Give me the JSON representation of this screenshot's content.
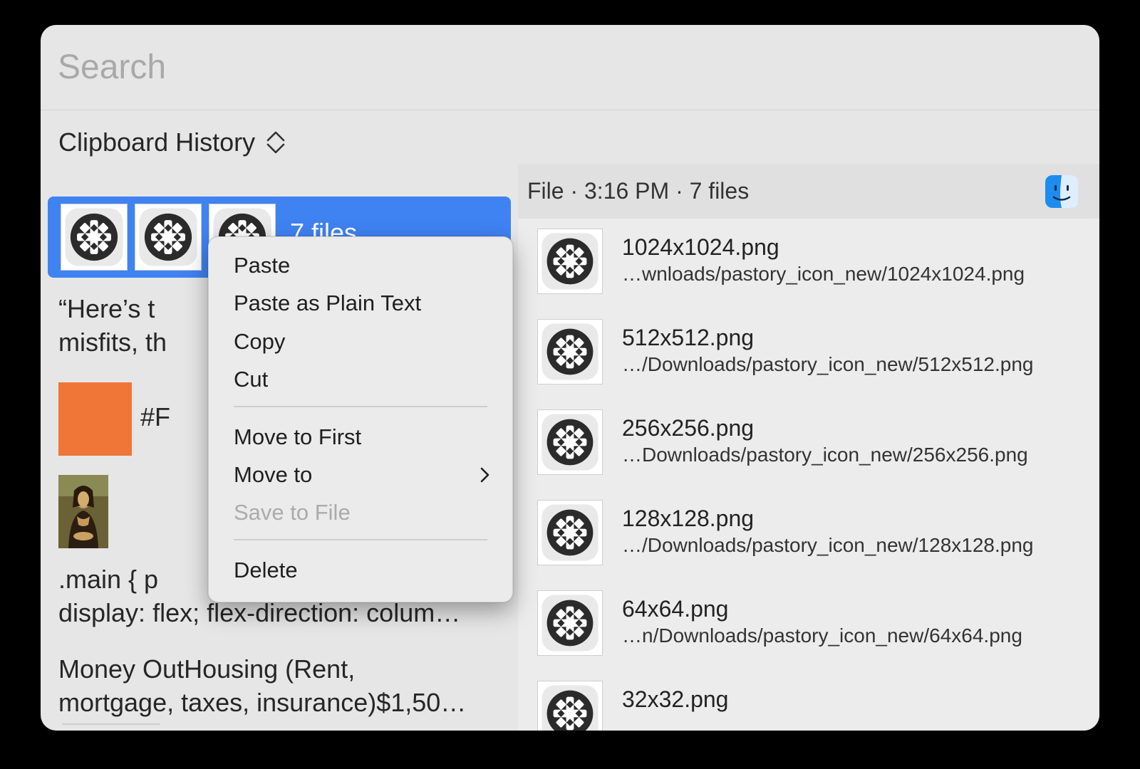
{
  "search": {
    "placeholder": "Search",
    "value": ""
  },
  "source": {
    "label": "Clipboard History",
    "icon": "up-down-chevron-icon"
  },
  "history": {
    "selected": {
      "count_label": "7 files",
      "icon": "pastory-app-icon"
    },
    "quote_line1": "“Here’s t",
    "quote_line2": "misfits, th",
    "quote_tail": "…",
    "color": {
      "swatch": "#F07638",
      "label": "#F"
    },
    "image_icon": "mona-lisa-thumbnail",
    "code_line1": ".main {  p",
    "code_line2": "display: flex;  flex-direction: colum…",
    "money_line1": "Money OutHousing (Rent,",
    "money_line2": "mortgage, taxes, insurance)$1,50…"
  },
  "detail": {
    "header": "File · 3:16 PM · 7 files",
    "icon": "finder-icon",
    "files": [
      {
        "name": "1024x1024.png",
        "path": "…wnloads/pastory_icon_new/1024x1024.png"
      },
      {
        "name": "512x512.png",
        "path": "…/Downloads/pastory_icon_new/512x512.png"
      },
      {
        "name": "256x256.png",
        "path": "…Downloads/pastory_icon_new/256x256.png"
      },
      {
        "name": "128x128.png",
        "path": "…/Downloads/pastory_icon_new/128x128.png"
      },
      {
        "name": "64x64.png",
        "path": "…n/Downloads/pastory_icon_new/64x64.png"
      },
      {
        "name": "32x32.png",
        "path": ""
      }
    ]
  },
  "context_menu": {
    "paste": "Paste",
    "paste_plain": "Paste as Plain Text",
    "copy": "Copy",
    "cut": "Cut",
    "move_first": "Move to First",
    "move_to": "Move to",
    "save_file": "Save to File",
    "delete": "Delete"
  },
  "colors": {
    "selection": "#3F82F2",
    "window": "#E6E6E6",
    "menu": "#EBEBEB"
  }
}
